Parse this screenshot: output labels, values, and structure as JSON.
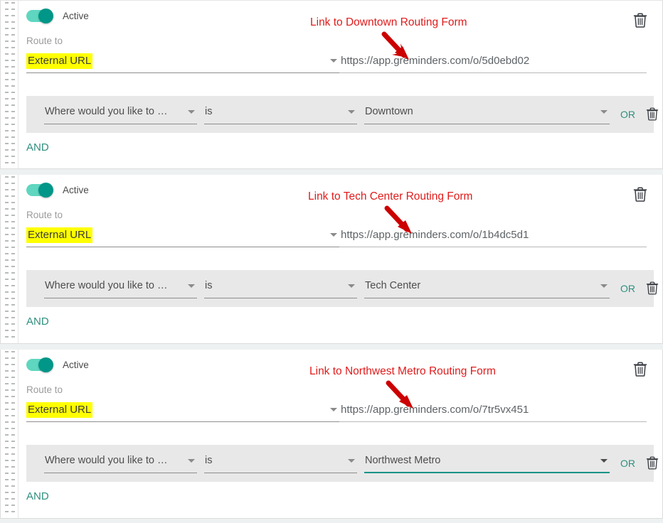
{
  "theme": {
    "page_bg": "#eef1f1",
    "card_bg": "#ffffff",
    "accent_teal": "#009688",
    "link_teal": "#2f8f7f",
    "annotation_red": "#e01b1b",
    "highlight_yellow": "#ffff00",
    "condition_bg": "#e8e8e8"
  },
  "labels": {
    "route_to": "Route to",
    "active": "Active",
    "and": "AND",
    "or": "OR"
  },
  "icons": {
    "card_delete": "trash-icon",
    "row_delete": "trash-icon",
    "dropdown": "chevron-down-icon",
    "drag": "drag-handle-icon",
    "pointer": "arrow-down-right-icon"
  },
  "rules": [
    {
      "active": true,
      "active_label": "Active",
      "route_to_label": "Route to",
      "route_to_value": "External URL",
      "url": "https://app.greminders.com/o/5d0ebd02",
      "annotation": "Link to Downtown Routing Form",
      "condition": {
        "field": "Where would you like to …",
        "operator": "is",
        "value": "Downtown",
        "value_focused": false,
        "or_label": "OR"
      },
      "and_label": "AND"
    },
    {
      "active": true,
      "active_label": "Active",
      "route_to_label": "Route to",
      "route_to_value": "External URL",
      "url": "https://app.greminders.com/o/1b4dc5d1",
      "annotation": "Link to Tech Center Routing Form",
      "condition": {
        "field": "Where would you like to …",
        "operator": "is",
        "value": "Tech Center",
        "value_focused": false,
        "or_label": "OR"
      },
      "and_label": "AND"
    },
    {
      "active": true,
      "active_label": "Active",
      "route_to_label": "Route to",
      "route_to_value": "External URL",
      "url": "https://app.greminders.com/o/7tr5vx451",
      "annotation": "Link to Northwest Metro Routing Form",
      "condition": {
        "field": "Where would you like to …",
        "operator": "is",
        "value": "Northwest Metro",
        "value_focused": true,
        "or_label": "OR"
      },
      "and_label": "AND"
    }
  ]
}
